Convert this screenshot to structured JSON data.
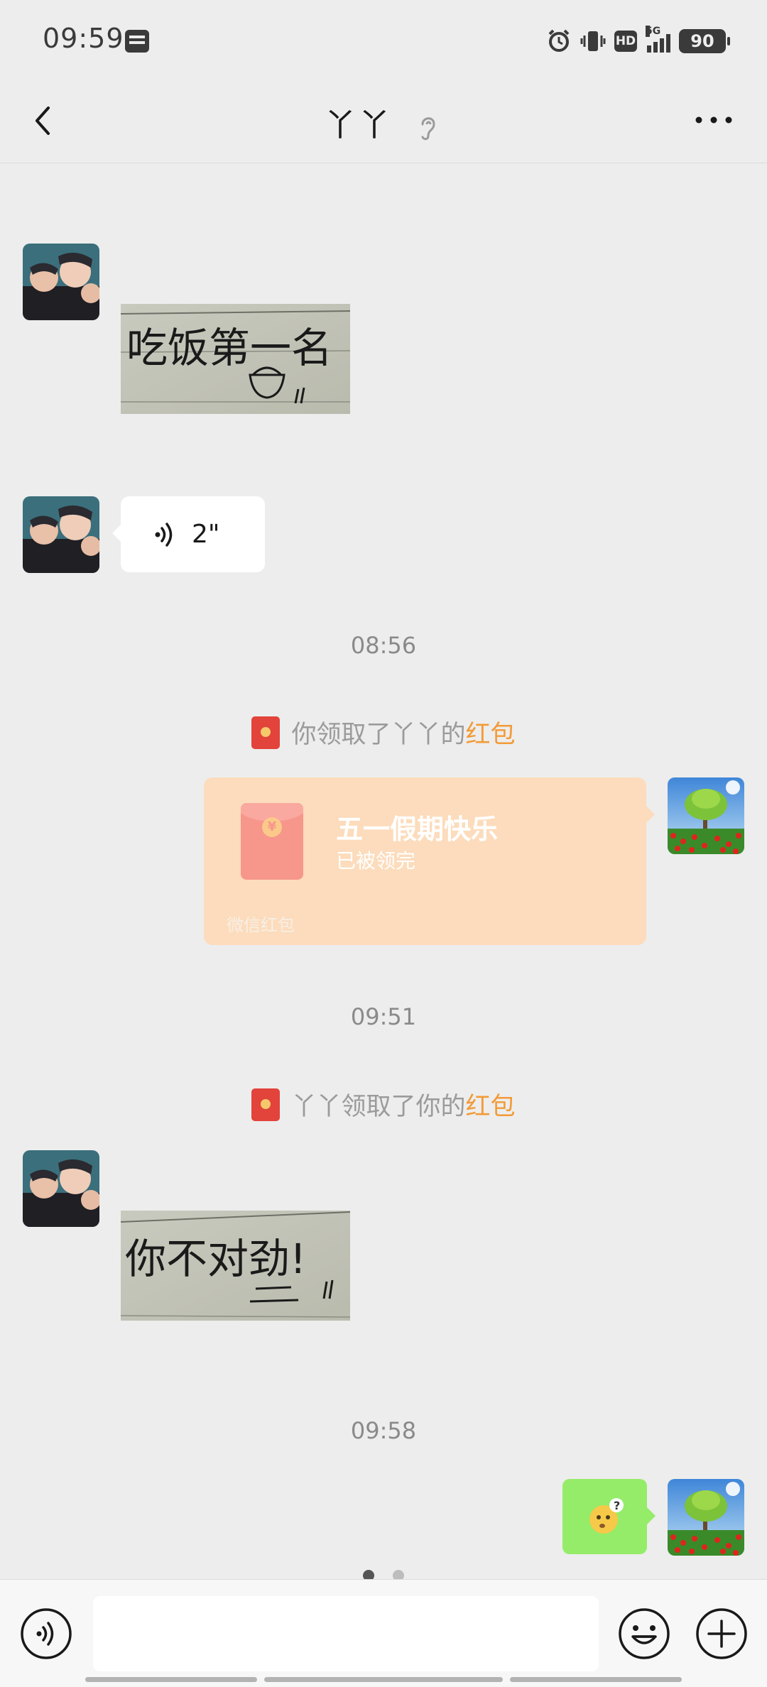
{
  "status_bar": {
    "time": "09:59",
    "hd": "HD",
    "network": "5G",
    "battery": "90",
    "icons": [
      "notification-icon",
      "alarm-icon",
      "vibrate-icon",
      "hd-icon",
      "signal-icon",
      "battery-icon"
    ]
  },
  "header": {
    "title": "丫丫",
    "back_icon": "chevron-left-icon",
    "ear_icon": "ear-icon",
    "more_icon": "more-icon"
  },
  "messages": {
    "sticker_1_text": "吃饭第一名",
    "voice_duration": "2\"",
    "time_1": "08:56",
    "system_1_text": "你领取了丫丫的",
    "system_1_highlight": "红包",
    "redpacket_title": "五一假期快乐",
    "redpacket_status": "已被领完",
    "redpacket_coin": "¥",
    "redpacket_footer": "微信红包",
    "time_2": "09:51",
    "system_2_text": "丫丫领取了你的",
    "system_2_highlight": "红包",
    "sticker_2_text": "你不对劲!",
    "time_3": "09:58"
  },
  "input_bar": {
    "value": "",
    "icons": [
      "voice-icon",
      "emoji-icon",
      "plus-icon"
    ]
  },
  "page_indicator": {
    "count": 2,
    "active": 1
  },
  "colors": {
    "background": "#ededed",
    "highlight": "#f29b38",
    "redpacket_bg": "#fcdcbc",
    "my_bubble": "#95ec69",
    "red_icon": "#e2433b"
  }
}
